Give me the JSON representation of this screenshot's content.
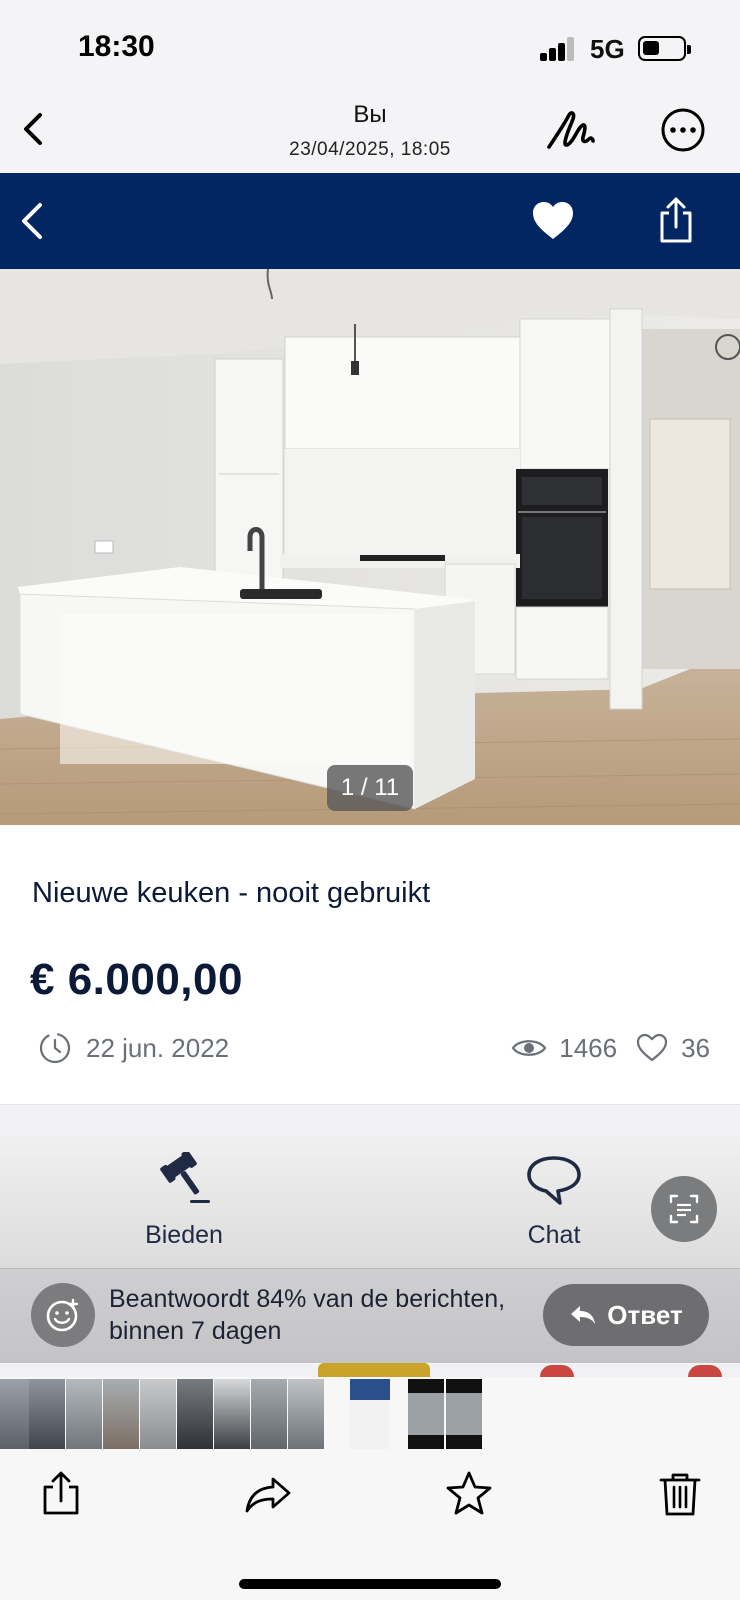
{
  "status_bar": {
    "time": "18:30",
    "network": "5G"
  },
  "viewer": {
    "sender": "Вы",
    "date": "23/04/2025, 18:05"
  },
  "photo": {
    "counter": "1 / 11"
  },
  "listing": {
    "title": "Nieuwe keuken - nooit gebruikt",
    "price": "€ 6.000,00",
    "date": "22 jun. 2022",
    "views": "1466",
    "likes": "36"
  },
  "actions": {
    "bid_label": "Bieden",
    "chat_label": "Chat"
  },
  "response": {
    "line1": "Beantwoordt  84% van de berichten,",
    "line2": "binnen  7 dagen",
    "reply_label": "Ответ"
  },
  "colors": {
    "nav": "#022661",
    "text_dark": "#0b1a36",
    "muted": "#6b6f78"
  },
  "icons": [
    "chevron-left-icon",
    "markup-icon",
    "more-icon",
    "heart-icon",
    "share-icon",
    "clock-icon",
    "eye-icon",
    "heart-outline-icon",
    "gavel-icon",
    "chat-bubble-icon",
    "scan-text-icon",
    "smiley-icon",
    "reply-arrow-icon",
    "forward-icon",
    "star-icon",
    "trash-icon"
  ]
}
